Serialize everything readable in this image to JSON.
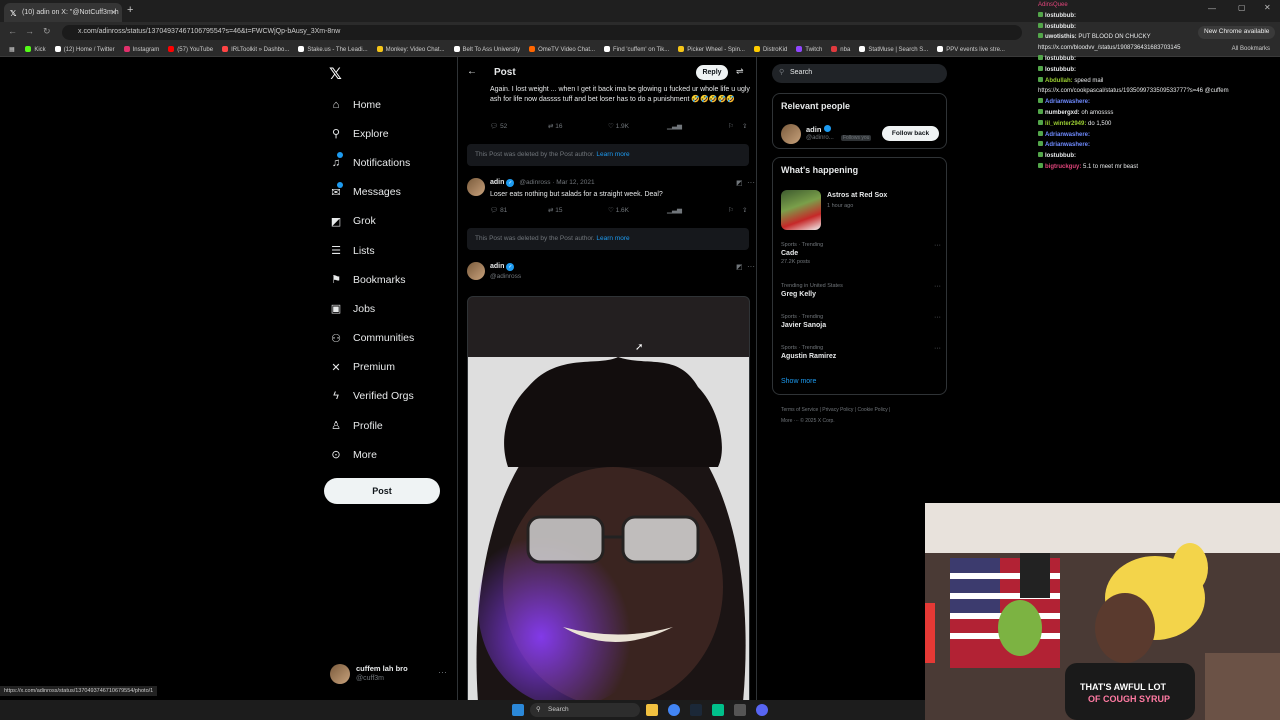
{
  "browser": {
    "tab_title": "(10) adin on X: \"@NotCuff3m h",
    "tab_close": "✕",
    "new_tab": "+",
    "url": "x.com/adinross/status/1370493746710679554?s=46&t=FWCWjQp-bAusy_3Xm-8nw",
    "new_chrome": "New Chrome available",
    "bookmarks": [
      {
        "label": "Kick",
        "color": "#53fc18"
      },
      {
        "label": "(12) Home / Twitter",
        "color": "#ffffff"
      },
      {
        "label": "Instagram",
        "color": "#e1306c"
      },
      {
        "label": "(57) YouTube",
        "color": "#ff0000"
      },
      {
        "label": "IRLToolkit » Dashbo...",
        "color": "#ff4444"
      },
      {
        "label": "Stake.us - The Leadi...",
        "color": "#ffffff"
      },
      {
        "label": "Monkey: Video Chat...",
        "color": "#f5c518"
      },
      {
        "label": "Belt To Ass University",
        "color": "#ffffff"
      },
      {
        "label": "OmeTV Video Chat...",
        "color": "#ff6600"
      },
      {
        "label": "Find 'cuffem' on Tik...",
        "color": "#ffffff"
      },
      {
        "label": "Picker Wheel - Spin...",
        "color": "#f5c518"
      },
      {
        "label": "DistroKid",
        "color": "#ffcc00"
      },
      {
        "label": "Twitch",
        "color": "#9146ff"
      },
      {
        "label": "nba",
        "color": "#e03a3e"
      },
      {
        "label": "StatMuse | Search S...",
        "color": "#ffffff"
      },
      {
        "label": "PPV events live stre...",
        "color": "#ffffff"
      }
    ],
    "all_bookmarks": "All Bookmarks",
    "status_url": "https://x.com/adinross/status/1370493746710679554/photo/1"
  },
  "sidebar": {
    "items": [
      {
        "label": "Home",
        "icon": "⌂",
        "name": "home"
      },
      {
        "label": "Explore",
        "icon": "⚲",
        "name": "explore"
      },
      {
        "label": "Notifications",
        "icon": "♫",
        "name": "notifications"
      },
      {
        "label": "Messages",
        "icon": "✉",
        "name": "messages"
      },
      {
        "label": "Grok",
        "icon": "◩",
        "name": "grok"
      },
      {
        "label": "Lists",
        "icon": "☰",
        "name": "lists"
      },
      {
        "label": "Bookmarks",
        "icon": "⚑",
        "name": "bookmarks"
      },
      {
        "label": "Jobs",
        "icon": "▣",
        "name": "jobs"
      },
      {
        "label": "Communities",
        "icon": "⚇",
        "name": "communities"
      },
      {
        "label": "Premium",
        "icon": "✕",
        "name": "premium"
      },
      {
        "label": "Verified Orgs",
        "icon": "ϟ",
        "name": "verified-orgs"
      },
      {
        "label": "Profile",
        "icon": "♙",
        "name": "profile"
      },
      {
        "label": "More",
        "icon": "⊙",
        "name": "more"
      }
    ],
    "post_label": "Post",
    "user_name": "cuffem lah bro",
    "user_handle": "@cuff3m"
  },
  "post_view": {
    "title": "Post",
    "reply_label": "Reply",
    "tweet1": {
      "text": "Again. I lost weight ... when I get it back ima be glowing u fucked ur whole life u ugly ash for life now dassss tuff and bet loser has to do a  punishment 🤣🤣🤣🤣🤣",
      "replies": "52",
      "retweets": "16",
      "likes": "1.9K"
    },
    "deleted_text": "This Post was deleted by the Post author.",
    "learn_more": "Learn more",
    "tweet2": {
      "name": "adin",
      "handle": "@adinross",
      "date": "· Mar 12, 2021",
      "text": "Loser eats nothing but salads  for a straight week. Deal?",
      "replies": "81",
      "retweets": "15",
      "likes": "1.6K"
    },
    "tweet3": {
      "name": "adin",
      "handle": "@adinross"
    }
  },
  "right": {
    "search_placeholder": "Search",
    "relevant_title": "Relevant people",
    "rp_name": "adin",
    "rp_handle": "@adinro...",
    "rp_follows": "Follows you",
    "follow_back": "Follow back",
    "happening_title": "What's happening",
    "event_title": "Astros at Red Sox",
    "event_sub": "1 hour ago",
    "trends": [
      {
        "cat": "Sports · Trending",
        "name": "Cade",
        "posts": "27.2K posts"
      },
      {
        "cat": "Trending in United States",
        "name": "Greg Kelly",
        "posts": ""
      },
      {
        "cat": "Sports · Trending",
        "name": "Javier Sanoja",
        "posts": ""
      },
      {
        "cat": "Sports · Trending",
        "name": "Agustin Ramirez",
        "posts": ""
      }
    ],
    "show_more": "Show more",
    "footer_line1": "Terms of Service  |  Privacy Policy  |  Cookie Policy  |",
    "footer_line2": "More ···  © 2025 X Corp."
  },
  "chat": [
    {
      "user": "",
      "text": "AdinsQuee",
      "color": "#e0457b"
    },
    {
      "user": "lostubbub:",
      "text": "",
      "color": "#e7e9ea"
    },
    {
      "user": "lostubbub:",
      "text": "",
      "color": "#e7e9ea"
    },
    {
      "user": "uwotisthis:",
      "text": "PUT BLOOD ON CHUCKY",
      "color": "#e7e9ea"
    },
    {
      "user": "",
      "text": "https://x.com/bloodvv_/status/1908736431683703145",
      "color": "#e7e9ea"
    },
    {
      "user": "lostubbub:",
      "text": "",
      "color": "#e7e9ea"
    },
    {
      "user": "lostubbub:",
      "text": "",
      "color": "#e7e9ea"
    },
    {
      "user": "Abdullah:",
      "text": "speed mail",
      "color": "#9acd32"
    },
    {
      "user": "",
      "text": "https://x.com/cookpascal/status/1935099733509533777?s=46 @cuffem",
      "color": "#e7e9ea"
    },
    {
      "user": "Adrianwashere:",
      "text": "",
      "color": "#6f8bff"
    },
    {
      "user": "numbergxd:",
      "text": "oh amossss",
      "color": "#e7e9ea"
    },
    {
      "user": "lil_winter2949:",
      "text": "do 1,500",
      "color": "#9acd32"
    },
    {
      "user": "Adrianwashere:",
      "text": "",
      "color": "#6f8bff"
    },
    {
      "user": "Adrianwashere:",
      "text": "",
      "color": "#6f8bff"
    },
    {
      "user": "lostubbub:",
      "text": "",
      "color": "#e7e9ea"
    },
    {
      "user": "bigtruckguy:",
      "text": "5.1 to meet mr beast",
      "color": "#e0457b"
    }
  ],
  "webcam": {
    "shirt_line1": "THAT'S AWFUL LOT",
    "shirt_line2": "OF COUGH SYRUP"
  },
  "taskbar": {
    "search_label": "Search"
  }
}
